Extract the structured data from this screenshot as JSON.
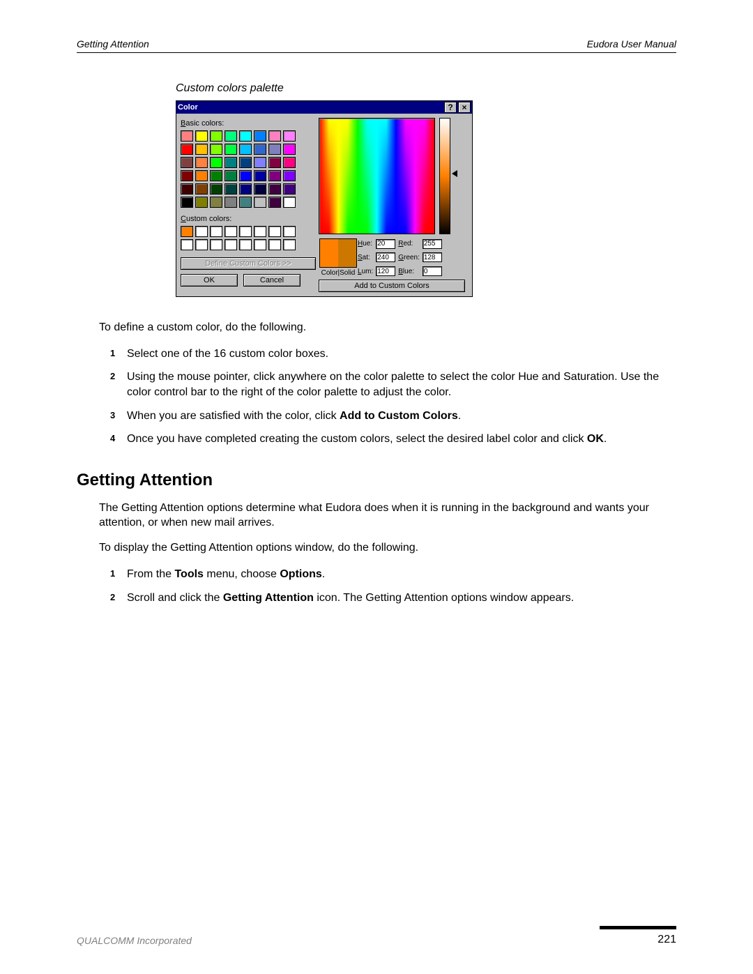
{
  "header": {
    "left": "Getting Attention",
    "right": "Eudora User Manual"
  },
  "caption": "Custom colors palette",
  "dialog": {
    "title": "Color",
    "help_glyph": "?",
    "close_glyph": "×",
    "basic_label": "Basic colors:",
    "custom_label": "Custom colors:",
    "define_btn": "Define Custom Colors >>",
    "ok": "OK",
    "cancel": "Cancel",
    "color_solid": "Color|Solid",
    "add_btn": "Add to Custom Colors",
    "hue_label": "Hue:",
    "sat_label": "Sat:",
    "lum_label": "Lum:",
    "red_label": "Red:",
    "green_label": "Green:",
    "blue_label": "Blue:",
    "hue": "20",
    "sat": "240",
    "lum": "120",
    "red": "255",
    "green": "128",
    "blue": "0",
    "preview_left": "#ff8000",
    "preview_right": "#cc7700",
    "basic_colors": [
      "#ff8080",
      "#ffff00",
      "#80ff00",
      "#00ff80",
      "#00ffff",
      "#0080ff",
      "#ff80c0",
      "#ff80ff",
      "#ff0000",
      "#ffc000",
      "#80ff00",
      "#00ff40",
      "#00c0ff",
      "#3366cc",
      "#8080c0",
      "#ff00ff",
      "#804040",
      "#ff8040",
      "#00ff00",
      "#008080",
      "#004080",
      "#8080ff",
      "#800040",
      "#ff0080",
      "#800000",
      "#ff8000",
      "#008000",
      "#008040",
      "#0000ff",
      "#0000a0",
      "#800080",
      "#8000ff",
      "#400000",
      "#804000",
      "#004000",
      "#004040",
      "#000080",
      "#000040",
      "#400040",
      "#400080",
      "#000000",
      "#808000",
      "#808040",
      "#808080",
      "#408080",
      "#c0c0c0",
      "#400040",
      "#ffffff"
    ],
    "custom_colors": [
      "#ff8000",
      "#ffffff",
      "#ffffff",
      "#ffffff",
      "#ffffff",
      "#ffffff",
      "#ffffff",
      "#ffffff",
      "#ffffff",
      "#ffffff",
      "#ffffff",
      "#ffffff",
      "#ffffff",
      "#ffffff",
      "#ffffff",
      "#ffffff"
    ]
  },
  "instructions": {
    "intro": "To define a custom color, do the following.",
    "steps": [
      "Select one of the 16 custom color boxes.",
      "Using the mouse pointer, click anywhere on the color palette to select the color Hue and Saturation. Use the color control bar to the right of the color palette to adjust the color.",
      "When you are satisfied with the color, click <b>Add to Custom Colors</b>.",
      "Once you have completed creating the custom colors, select the desired label color and click <b>OK</b>."
    ]
  },
  "section": {
    "heading": "Getting Attention",
    "p1": "The Getting Attention options determine what Eudora does when it is running in the background and wants your attention, or when new mail arrives.",
    "p2": "To display the Getting Attention options window, do the following.",
    "steps": [
      "From the <b>Tools</b> menu, choose <b>Options</b>.",
      "Scroll and click the <b>Getting Attention</b> icon. The Getting Attention options window appears."
    ]
  },
  "footer": {
    "company": "QUALCOMM Incorporated",
    "page": "221"
  }
}
